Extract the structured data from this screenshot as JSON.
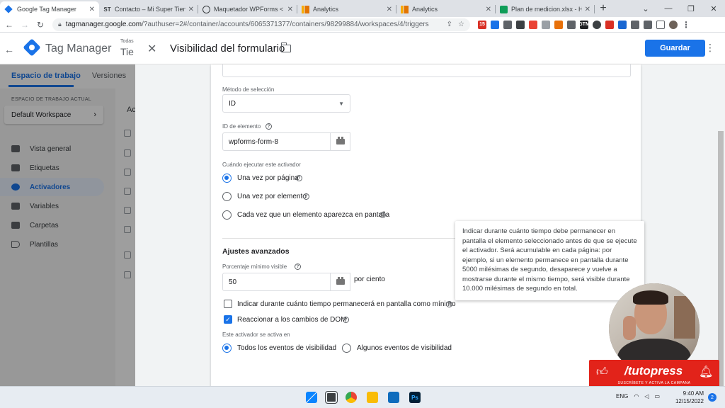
{
  "browser": {
    "tabs": [
      {
        "label": "Google Tag Manager",
        "icon": "gtm-favicon",
        "active": true
      },
      {
        "label": "Contacto – Mi Super Tiend",
        "icon": "st-favicon",
        "favicon_text": "ST"
      },
      {
        "label": "Maquetador WPForms < M",
        "icon": "wordpress-favicon"
      },
      {
        "label": "Analytics",
        "icon": "analytics-favicon"
      },
      {
        "label": "Analytics",
        "icon": "analytics-favicon"
      },
      {
        "label": "Plan de medicion.xlsx - Hoj",
        "icon": "sheets-favicon"
      }
    ],
    "new_tab": "+",
    "url_host": "tagmanager.google.com",
    "url_path": "/?authuser=2#/container/accounts/6065371377/containers/98299884/workspaces/4/triggers"
  },
  "gtm": {
    "product": "Tag Manager",
    "account_small": "Todas",
    "account_big": "Tie",
    "nav_tabs": [
      "Espacio de trabajo",
      "Versiones",
      "A"
    ],
    "workspace_caption": "ESPACIO DE TRABAJO ACTUAL",
    "workspace_name": "Default Workspace",
    "sidebar": [
      {
        "label": "Vista general",
        "icon": "folder-icon"
      },
      {
        "label": "Etiquetas",
        "icon": "tag-icon"
      },
      {
        "label": "Activadores",
        "icon": "trigger-icon",
        "active": true
      },
      {
        "label": "Variables",
        "icon": "variables-icon"
      },
      {
        "label": "Carpetas",
        "icon": "folder-icon"
      },
      {
        "label": "Plantillas",
        "icon": "template-icon"
      }
    ],
    "bg_heading": "Ac"
  },
  "panel": {
    "title": "Visibilidad del formulario",
    "save": "Guardar",
    "selection_method_label": "Método de selección",
    "selection_method_value": "ID",
    "element_id_label": "ID de elemento",
    "element_id_value": "wpforms-form-8",
    "when_label": "Cuándo ejecutar este activador",
    "when_options": [
      {
        "label": "Una vez por página",
        "checked": true
      },
      {
        "label": "Una vez por elemento",
        "checked": false
      },
      {
        "label": "Cada vez que un elemento aparezca en pantalla",
        "checked": false
      }
    ],
    "advanced_title": "Ajustes avanzados",
    "min_percent_label": "Porcentaje mínimo visible",
    "min_percent_value": "50",
    "min_percent_unit": "por ciento",
    "min_time_label": "Indicar durante cuánto tiempo permanecerá en pantalla como mínimo",
    "min_time_checked": false,
    "dom_changes_label": "Reaccionar a los cambios de DOM",
    "dom_changes_checked": true,
    "fires_on_label": "Este activador se activa en",
    "fires_on_options": [
      {
        "label": "Todos los eventos de visibilidad",
        "checked": true
      },
      {
        "label": "Algunos eventos de visibilidad",
        "checked": false
      }
    ],
    "tooltip": "Indicar durante cuánto tiempo debe permanecer en pantalla el elemento seleccionado antes de que se ejecute el activador. Será acumulable en cada página: por ejemplo, si un elemento permanece en pantalla durante 5000 milésimas de segundo, desaparece y vuelve a mostrarse durante el mismo tiempo, será visible durante 10.000 milésimas de segundo en total."
  },
  "brand": {
    "name": "/tutopress",
    "tagline": "SUSCRÍBETE Y ACTIVA LA CAMPANA"
  },
  "taskbar": {
    "lang": "ENG",
    "time": "9:40 AM",
    "date": "12/15/2022",
    "notifications": "2"
  },
  "colors": {
    "accent": "#1a73e8",
    "brand_red": "#e2231a"
  }
}
